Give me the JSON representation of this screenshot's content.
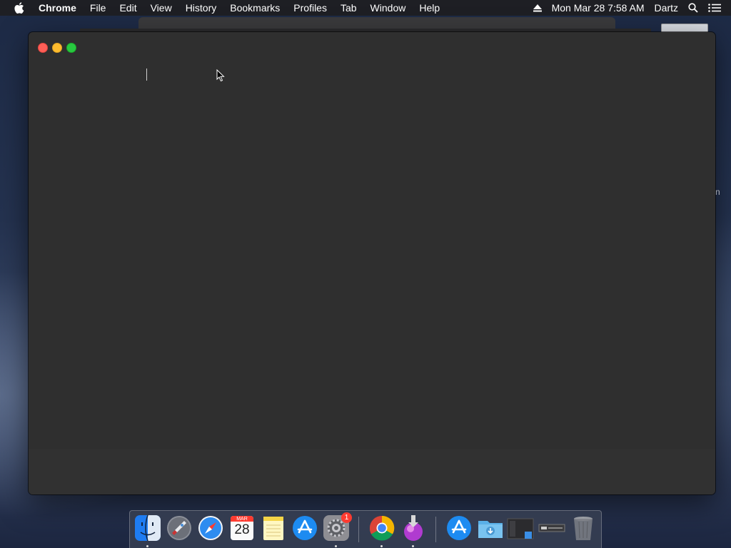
{
  "menubar": {
    "app_name": "Chrome",
    "menus": [
      "File",
      "Edit",
      "View",
      "History",
      "Bookmarks",
      "Profiles",
      "Tab",
      "Window",
      "Help"
    ],
    "clock": "Mon Mar 28  7:58 AM",
    "user": "Dartz"
  },
  "desktop": {
    "edge_text": "n"
  },
  "window": {
    "traffic_lights": {
      "close": "#fe5f57",
      "minimize": "#febc2e",
      "zoom": "#28c840"
    }
  },
  "dock": {
    "items": [
      {
        "name": "Finder",
        "icon": "finder-icon",
        "running": true
      },
      {
        "name": "Launchpad",
        "icon": "rocket-icon",
        "running": false
      },
      {
        "name": "Safari",
        "icon": "compass-icon",
        "running": false
      },
      {
        "name": "Calendar",
        "icon": "calendar-icon",
        "month": "MAR",
        "day": "28",
        "running": false
      },
      {
        "name": "Notes",
        "icon": "notes-icon",
        "running": false
      },
      {
        "name": "App Store",
        "icon": "app-store-icon",
        "running": false
      },
      {
        "name": "System Preferences",
        "icon": "gear-icon",
        "badge": "1",
        "running": true
      },
      {
        "name": "Google Chrome",
        "icon": "chrome-icon",
        "running": true
      },
      {
        "name": "Installer",
        "icon": "installer-icon",
        "running": true
      },
      {
        "name": "App Store Folder",
        "icon": "app-store-icon",
        "running": false
      },
      {
        "name": "Downloads",
        "icon": "folder-download-icon",
        "running": false
      },
      {
        "name": "Screenshot",
        "icon": "screenshot-icon",
        "running": false
      },
      {
        "name": "Window Preview",
        "icon": "window-preview-icon",
        "running": false
      },
      {
        "name": "Trash",
        "icon": "trash-icon",
        "running": false
      }
    ]
  }
}
